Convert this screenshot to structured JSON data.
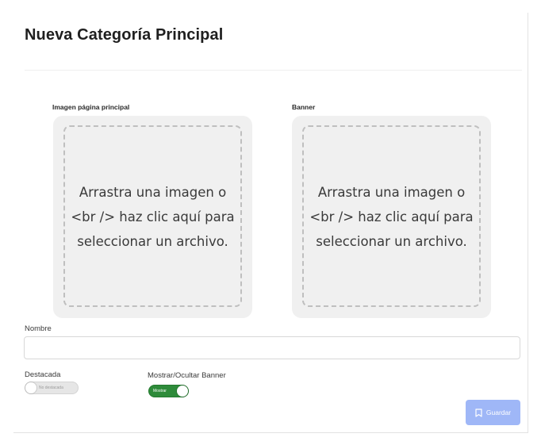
{
  "page": {
    "title": "Nueva Categoría Principal"
  },
  "uploads": {
    "main_image": {
      "label": "Imagen página principal",
      "dropzone_text": "Arrastra una imagen o <br /> haz clic aquí para seleccionar un archivo."
    },
    "banner": {
      "label": "Banner",
      "dropzone_text": "Arrastra una imagen o <br /> haz clic aquí para seleccionar un archivo."
    }
  },
  "form": {
    "name": {
      "label": "Nombre",
      "value": "",
      "placeholder": ""
    },
    "featured": {
      "label": "Destacada",
      "state_text": "No destacada",
      "checked": false
    },
    "banner_visibility": {
      "label": "Mostrar/Ocultar Banner",
      "state_text": "Mostrar",
      "checked": true
    }
  },
  "actions": {
    "save_label": "Guardar",
    "save_icon": "save-icon"
  },
  "colors": {
    "toggle_on": "#2e8b3a",
    "save_button": "#9fb7f7",
    "dropzone_bg": "#f0f0f0"
  }
}
